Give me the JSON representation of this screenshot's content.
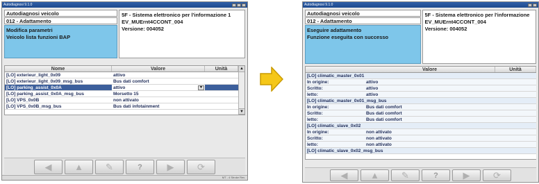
{
  "colors": {
    "header_blue": "#7ec6ea",
    "selection": "#3c5f9c",
    "arrow_fill": "#f5c718",
    "arrow_stroke": "#c99a00"
  },
  "left": {
    "titlebar": "Autodiagnosi 9.1.0",
    "header": {
      "row1": "Autodiagnosi veicolo",
      "row2": "012 - Adattamento",
      "blue_lines": [
        "Modifica parametri",
        "Veicolo lista funzioni BAP"
      ],
      "info_lines": [
        "5F - Sistema elettronico per l'informazione 1",
        "EV_MUErnt4CCONT_004",
        "Versione: 004052"
      ]
    },
    "table": {
      "col_name": "Nome",
      "col_value": "Valore",
      "col_unit": "Unità",
      "rows": [
        {
          "name": "[LO] exterieur_light_0x09",
          "value": "attivo"
        },
        {
          "name": "[LO] exterieur_light_0x09_msg_bus",
          "value": "Bus dati comfort"
        },
        {
          "name": "[LO] parking_assist_0x0A",
          "value": "attivo"
        },
        {
          "name": "[LO] parking_assist_0x0A_msg_bus",
          "value": "Morsetto 15"
        },
        {
          "name": "[LO] VPS_0x0B",
          "value": "non attivato"
        },
        {
          "name": "[LO] VPS_0x0B_msg_bus",
          "value": "Bus dati infotainment"
        }
      ]
    },
    "toolbar": [
      "◀",
      "▲",
      "✎",
      "?",
      "▶",
      "⟳"
    ],
    "status": "MT - 4 Stroke Rev."
  },
  "right": {
    "titlebar": "Autodiagnosi 9.1.0",
    "header": {
      "row1": "Autodiagnosi veicolo",
      "row2": "012 - Adattamento",
      "blue_lines": [
        "Eseguire adattamento",
        "Funzione eseguita con successo"
      ],
      "info_lines": [
        "5F - Sistema elettronico per l'informazione",
        "EV_MUErnt4CCONT_004",
        "Versione: 004052"
      ]
    },
    "table": {
      "col_value": "Valore",
      "col_unit": "Unità",
      "rows": [
        {
          "type": "group",
          "name": "[LO] climatic_master_0x01"
        },
        {
          "type": "sub",
          "name": "In origine:",
          "value": "attivo"
        },
        {
          "type": "sub",
          "name": "Scritto:",
          "value": "attivo"
        },
        {
          "type": "sub",
          "name": "letto:",
          "value": "attivo"
        },
        {
          "type": "group",
          "name": "[LO] climatic_master_0x01_msg_bus"
        },
        {
          "type": "sub",
          "name": "In origine:",
          "value": "Bus dati comfort"
        },
        {
          "type": "sub",
          "name": "Scritto:",
          "value": "Bus dati comfort"
        },
        {
          "type": "sub",
          "name": "letto:",
          "value": "Bus dati comfort"
        },
        {
          "type": "group",
          "name": "[LO] climatic_slave_0x02"
        },
        {
          "type": "sub",
          "name": "In origine:",
          "value": "non attivato"
        },
        {
          "type": "sub",
          "name": "Scritto:",
          "value": "non attivato"
        },
        {
          "type": "sub",
          "name": "letto:",
          "value": "non attivato"
        },
        {
          "type": "group",
          "name": "[LO] climatic_slave_0x02_msg_bus"
        }
      ]
    },
    "toolbar": [
      "◀",
      "▲",
      "✎",
      "?",
      "▶",
      "⟳"
    ]
  }
}
